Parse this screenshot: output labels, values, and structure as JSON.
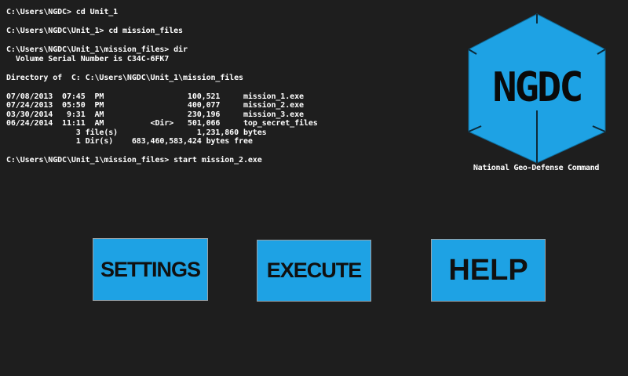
{
  "terminal": {
    "lines": [
      "C:\\Users\\NGDC> cd Unit_1",
      "",
      "C:\\Users\\NGDC\\Unit_1> cd mission_files",
      "",
      "C:\\Users\\NGDC\\Unit_1\\mission_files> dir",
      "  Volume Serial Number is C34C-6FK7",
      "",
      "Directory of  C: C:\\Users\\NGDC\\Unit_1\\mission_files",
      "",
      "07/08/2013  07:45  PM                  100,521     mission_1.exe",
      "07/24/2013  05:50  PM                  400,077     mission_2.exe",
      "03/30/2014   9:31  AM                  230,196     mission_3.exe",
      "06/24/2014  11:11  AM          <Dir>   501,066     top_secret_files",
      "               3 file(s)                 1,231,860 bytes",
      "               1 Dir(s)    683,460,583,424 bytes free",
      "",
      "C:\\Users\\NGDC\\Unit_1\\mission_files> start mission_2.exe"
    ]
  },
  "logo": {
    "text": "NGDC",
    "caption": "National Geo-Defense Command",
    "color": "#1ea2e4"
  },
  "buttons": {
    "settings": "SETTINGS",
    "execute": "EXECUTE",
    "help": "HELP"
  },
  "colors": {
    "background": "#1e1e1e",
    "button": "#1ea2e4",
    "text": "#ffffff"
  }
}
